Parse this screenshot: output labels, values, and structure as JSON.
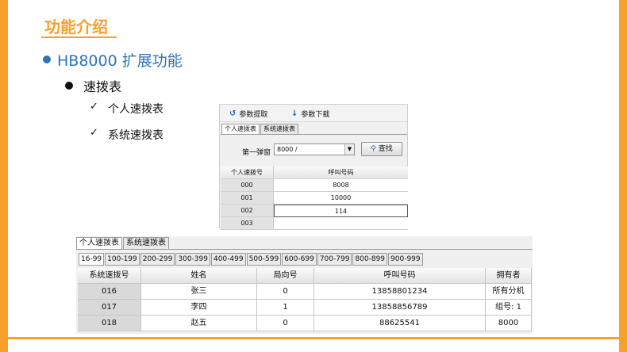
{
  "slide": {
    "title": "功能介绍",
    "heading": "HB8000 扩展功能",
    "subheading": "速拨表",
    "items": [
      "个人速拨表",
      "系统速拨表"
    ],
    "check_mark": "✓",
    "accent_color": "#F7A12B",
    "heading_color": "#2E75B6"
  },
  "top_panel": {
    "toolbar": {
      "fetch_label": "参数提取",
      "fetch_icon": "↺",
      "download_label": "参数下载",
      "download_icon": "↓"
    },
    "tabs": [
      "个人速拨表",
      "系统速拨表"
    ],
    "segment_label": "第一弹窗",
    "segment_value": "8000 /",
    "dropdown_arrow": "▼",
    "find_button": "查找",
    "find_icon": "⚲",
    "columns": [
      "个人速拨号",
      "呼叫号码"
    ],
    "rows": [
      {
        "id": "000",
        "number": "8008"
      },
      {
        "id": "001",
        "number": "10000"
      },
      {
        "id": "002",
        "number": "114"
      },
      {
        "id": "003",
        "number": ""
      }
    ]
  },
  "bottom_panel": {
    "tabs": [
      "个人速拨表",
      "系统速拨表"
    ],
    "range_tabs": [
      "16-99",
      "100-199",
      "200-299",
      "300-399",
      "400-499",
      "500-599",
      "600-699",
      "700-799",
      "800-899",
      "900-999"
    ],
    "columns": [
      "系统速拨号",
      "姓名",
      "局向号",
      "呼叫号码",
      "拥有者"
    ],
    "rows": [
      {
        "id": "016",
        "name": "张三",
        "route": "0",
        "number": "13858801234",
        "owner": "所有分机"
      },
      {
        "id": "017",
        "name": "李四",
        "route": "1",
        "number": "13858856789",
        "owner": "组号: 1"
      },
      {
        "id": "018",
        "name": "赵五",
        "route": "0",
        "number": "88625541",
        "owner": "8000"
      }
    ]
  }
}
